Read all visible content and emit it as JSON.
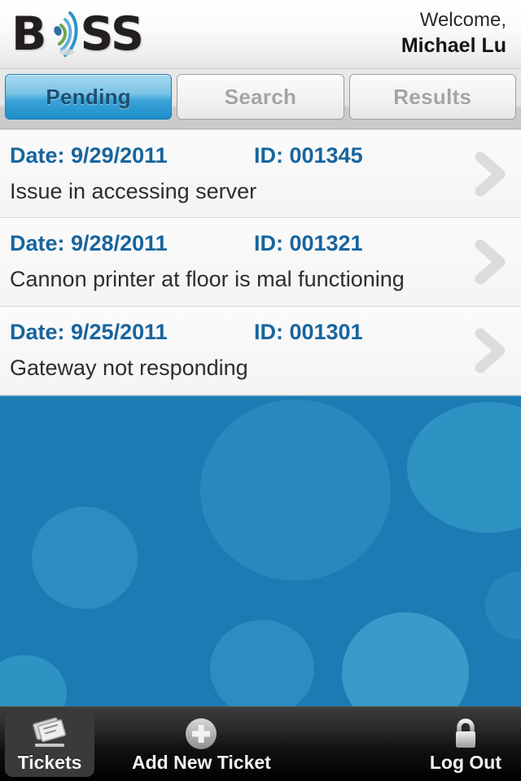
{
  "header": {
    "logo_text_before": "B",
    "logo_text_after": "SS",
    "logo_alt": "BOSS",
    "welcome_greeting": "Welcome,",
    "user_name": "Michael Lu"
  },
  "tabs": [
    {
      "label": "Pending",
      "active": true
    },
    {
      "label": "Search",
      "active": false
    },
    {
      "label": "Results",
      "active": false
    }
  ],
  "tickets": [
    {
      "date_label": "Date: 9/29/2011",
      "id_label": "ID: 001345",
      "subject": "Issue in accessing server"
    },
    {
      "date_label": "Date: 9/28/2011",
      "id_label": "ID: 001321",
      "subject": "Cannon printer at floor is mal functioning"
    },
    {
      "date_label": "Date: 9/25/2011",
      "id_label": "ID: 001301",
      "subject": "Gateway not responding"
    }
  ],
  "toolbar": [
    {
      "label": "Tickets",
      "icon": "tickets-icon",
      "active": true
    },
    {
      "label": "Add New Ticket",
      "icon": "plus-circle-icon",
      "active": false
    },
    {
      "label": "Log Out",
      "icon": "lock-icon",
      "active": false
    }
  ],
  "colors": {
    "accent_blue": "#17659e",
    "tab_active_blue": "#1c8ec9",
    "filler_blue": "#1a7cb3",
    "filler_bokeh": "#2f8fc3",
    "toolbar_black": "#000000",
    "chevron_gray": "#dcdcdc"
  }
}
